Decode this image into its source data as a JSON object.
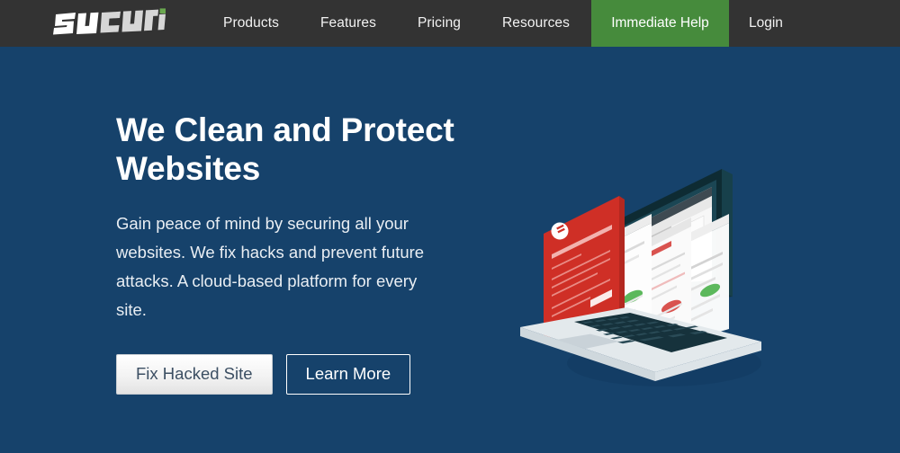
{
  "header": {
    "logo": {
      "name": "sucuri",
      "text": "sucuri",
      "accent_color": "#6aa84f",
      "text_color": "#ffffff"
    },
    "nav_items": [
      {
        "label": "Products"
      },
      {
        "label": "Features"
      },
      {
        "label": "Pricing"
      },
      {
        "label": "Resources"
      }
    ],
    "cta": {
      "label": "Immediate Help",
      "background": "#468b3c",
      "color": "#ffffff"
    },
    "login": {
      "label": "Login"
    },
    "background": "#333333"
  },
  "hero": {
    "background": "#16426b",
    "title": "We Clean and Protect Websites",
    "paragraph": "Gain peace of mind by securing all your websites. We fix hacks and prevent future attacks. A cloud-based platform for every site.",
    "buttons": {
      "primary": {
        "label": "Fix Hacked Site"
      },
      "secondary": {
        "label": "Learn More"
      }
    },
    "illustration": {
      "name": "isometric-laptop-with-security-dashboard",
      "laptop_body_color": "#e3e9ec",
      "laptop_screen_color": "#1f3b46",
      "keyboard_key_color": "#16323c",
      "warning_panel_color": "#cf2f26",
      "dashboard_panel_color": "#f7f7f7",
      "status_ok_color": "#5cb85c",
      "status_alert_color": "#d9534f"
    }
  }
}
